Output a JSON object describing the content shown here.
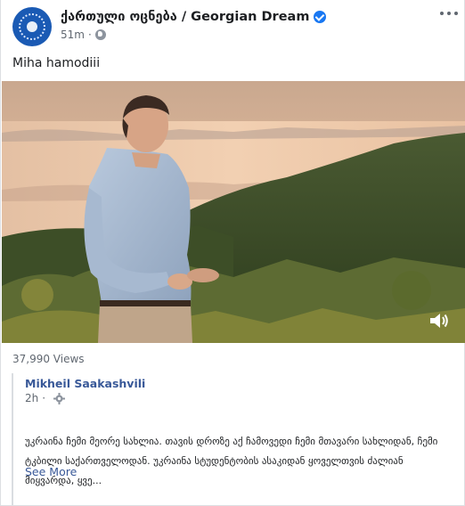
{
  "post": {
    "page_name": "ქართული ოცნება / Georgian Dream",
    "time": "51m",
    "dot": "·",
    "caption": "Miha hamodiii",
    "views": "37,990 Views",
    "avatar_text": "GEORGIAN DREAM",
    "verified": true
  },
  "shared_post": {
    "author": "Mikheil Saakashvili",
    "time": "2h",
    "dot": "·",
    "text": "უკრაინა ჩემი მეორე სახლია. თავის დროზე აქ ჩამოვედი ჩემი მთავარი სახლიდან, ჩემი ტკბილი საქართველოდან. უკრაინა სტუდენტობის ასაკიდან ყოველთვის ძალიან მიყვარდა, ყვე...",
    "see_more": "See More"
  },
  "icons": {
    "more": "more-options-icon",
    "verified": "verified-badge-icon",
    "privacy": "globe-icon",
    "volume": "volume-icon",
    "gear": "gear-icon"
  },
  "colors": {
    "link": "#385898",
    "verified": "#1877f2",
    "muted": "#606770",
    "avatar_bg": "#1a5ab4"
  }
}
